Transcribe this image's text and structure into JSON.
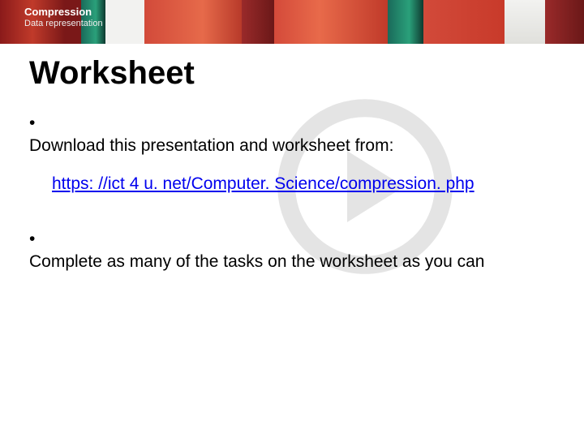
{
  "header": {
    "title": "Compression",
    "subtitle": "Data representation"
  },
  "slide": {
    "title": "Worksheet",
    "bullets": [
      "Download this presentation and worksheet from:",
      "Complete as many of the tasks on the worksheet as you can"
    ],
    "link_text": "https: //ict 4 u. net/Computer. Science/compression. php"
  }
}
